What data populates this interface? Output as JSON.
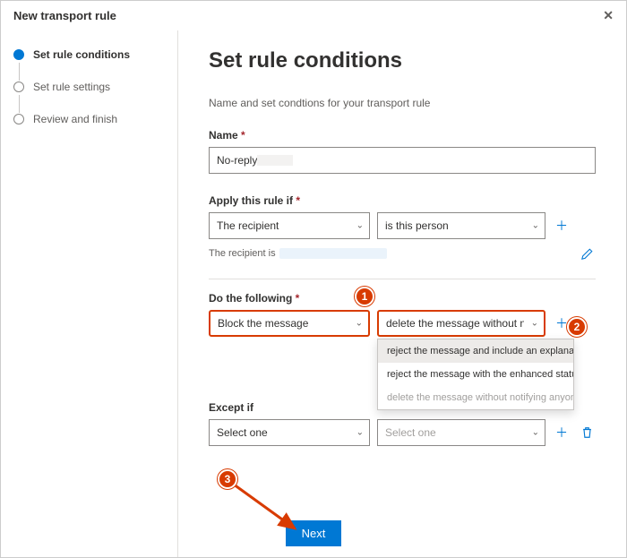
{
  "header": {
    "title": "New transport rule"
  },
  "sidebar": {
    "steps": [
      "Set rule conditions",
      "Set rule settings",
      "Review and finish"
    ]
  },
  "main": {
    "heading": "Set rule conditions",
    "subtitle": "Name and set condtions for your transport rule",
    "name_label": "Name",
    "name_value": "No-reply",
    "apply_label": "Apply this rule if",
    "apply_a": "The recipient",
    "apply_b": "is this person",
    "recipient_text": "The recipient is",
    "do_label": "Do the following",
    "do_a": "Block the message",
    "do_b": "delete the message without notif...",
    "except_label": "Except if",
    "except_a": "Select one",
    "except_b": "Select one",
    "dropdown": {
      "opt1": "reject the message and include an explanation",
      "opt2": "reject the message with the enhanced status code of",
      "opt3": "delete the message without notifying anyone"
    },
    "callouts": {
      "c1": "1",
      "c2": "2",
      "c3": "3"
    },
    "next": "Next"
  }
}
